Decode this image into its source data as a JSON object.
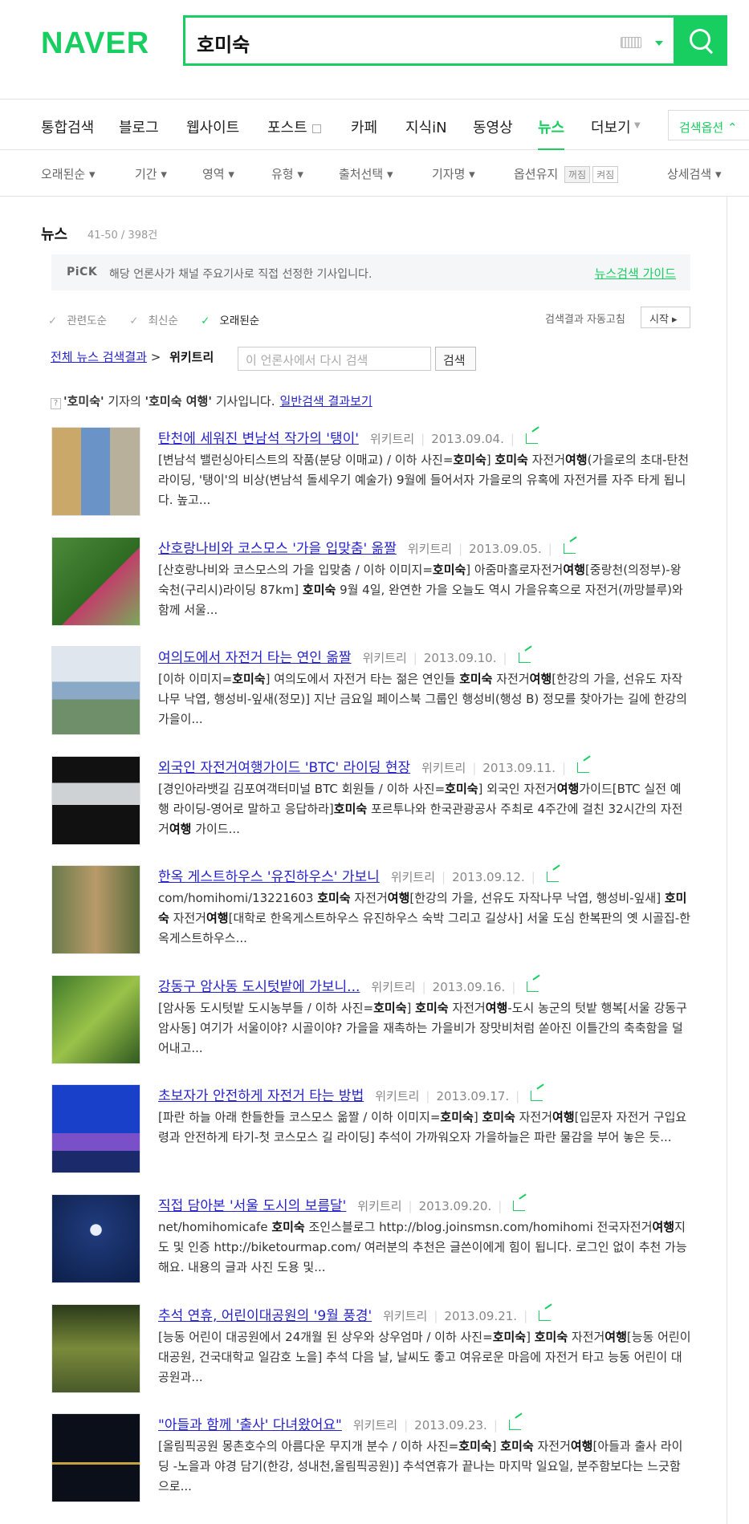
{
  "brand": {
    "logo": "NAVER",
    "brand_color": "#19ce60"
  },
  "search": {
    "query": "호미숙"
  },
  "tabs": [
    {
      "label": "통합검색"
    },
    {
      "label": "블로그"
    },
    {
      "label": "웹사이트"
    },
    {
      "label": "포스트"
    },
    {
      "label": "카페"
    },
    {
      "label": "지식iN"
    },
    {
      "label": "동영상"
    },
    {
      "label": "뉴스"
    },
    {
      "label": "더보기"
    }
  ],
  "search_options": "검색옵션",
  "filters": {
    "sort": "오래된순",
    "period": "기간",
    "area": "영역",
    "type": "유형",
    "source": "출처선택",
    "reporter": "기자명",
    "keep_label": "옵션유지",
    "keep_on": "꺼짐",
    "keep_off": "켜짐",
    "detail": "상세검색"
  },
  "section": {
    "title": "뉴스",
    "count": "41-50 / 398건"
  },
  "pick": {
    "label": "PiCK",
    "text": "해당 언론사가 채널 주요기사로 직접 선정한 기사입니다.",
    "guide": "뉴스검색 가이드"
  },
  "sort_opts": [
    {
      "label": "관련도순"
    },
    {
      "label": "최신순"
    },
    {
      "label": "오래된순"
    }
  ],
  "autofix": {
    "label": "검색결과 자동고침",
    "button": "시작"
  },
  "press": {
    "all_link": "전체 뉴스 검색결과",
    "current": "위키트리",
    "placeholder": "이 언론사에서 다시 검색",
    "button": "검색"
  },
  "reporter_note": {
    "q": "?",
    "part1": "'호미숙'",
    "part2": " 기자의 ",
    "part3": "'호미숙 여행'",
    "part4": " 기사입니다.",
    "link": "일반검색 결과보기"
  },
  "articles": [
    {
      "title": "탄천에 세워진 변남석 작가의 '탱이'",
      "press": "위키트리",
      "date": "2013.09.04.",
      "desc": "[변남석 밸런싱아티스트의 작품(분당 이매교) / 이하 사진=호미숙] 호미숙 자전거여행(가을로의 초대-탄천 라이딩, '탱이'의 비상(변남석 돌세우기 예술가) 9월에 들어서자 가을로의 유혹에 자전거를 자주 타게 됩니다. 높고..."
    },
    {
      "title": "산호랑나비와 코스모스 '가을 입맞춤' 옮짤",
      "press": "위키트리",
      "date": "2013.09.05.",
      "desc": "[산호랑나비와 코스모스의 가을 입맞춤 / 이하 이미지=호미숙] 아줌마홀로자전거여행[중랑천(의정부)-왕숙천(구리시)라이딩 87km] 호미숙 9월 4일, 완연한 가을 오늘도 역시 가을유혹으로 자전거(까망블루)와 함께 서울..."
    },
    {
      "title": "여의도에서 자전거 타는 연인 옮짤",
      "press": "위키트리",
      "date": "2013.09.10.",
      "desc": "[이하 이미지=호미숙] 여의도에서 자전거 타는 젊은 연인들 호미숙 자전거여행[한강의 가을, 선유도 자작나무 낙엽, 행성비-잎새(정모)] 지난 금요일 페이스북 그룹인 행성비(행성 B) 정모를 찾아가는 길에 한강의 가을이..."
    },
    {
      "title": "외국인 자전거여행가이드 'BTC' 라이딩 현장",
      "press": "위키트리",
      "date": "2013.09.11.",
      "desc": "[경인아라뱃길 김포여객터미널 BTC 회원들 / 이하 사진=호미숙] 외국인 자전거여행가이드[BTC 실전 예행 라이딩-영어로 말하고 응답하라]호미숙 포르투나와 한국관광공사 주최로 4주간에 걸친 32시간의 자전거여행 가이드..."
    },
    {
      "title": "한옥 게스트하우스 '유진하우스' 가보니",
      "press": "위키트리",
      "date": "2013.09.12.",
      "desc": "com/homihomi/13221603 호미숙 자전거여행[한강의 가을, 선유도 자작나무 낙엽, 행성비-잎새] 호미숙 자전거여행[대학로 한옥게스트하우스 유진하우스 숙박 그리고 길상사] 서울 도심 한복판의 옛 시골집-한옥게스트하우스..."
    },
    {
      "title": "강동구 암사동 도시텃밭에 가보니...",
      "press": "위키트리",
      "date": "2013.09.16.",
      "desc": "[암사동 도시텃밭 도시농부들 / 이하 사진=호미숙] 호미숙 자전거여행-도시 농군의 텃밭 행복[서울 강동구 암사동] 여기가 서울이야? 시골이야? 가을을 재촉하는 가을비가 장맛비처럼 쏟아진 이틀간의 축축함을 덜어내고..."
    },
    {
      "title": "초보자가 안전하게 자전거 타는 방법",
      "press": "위키트리",
      "date": "2013.09.17.",
      "desc": "[파란 하늘 아래 한들한들 코스모스 옮짤 / 이하 이미지=호미숙] 호미숙 자전거여행[입문자 자전거 구입요령과 안전하게 타기-첫 코스모스 길 라이딩] 추석이 가까워오자 가을하늘은 파란 물감을 부어 놓은 듯..."
    },
    {
      "title": "직접 담아본 '서울 도시의 보름달'",
      "press": "위키트리",
      "date": "2013.09.20.",
      "desc": "net/homihomicafe 호미숙 조인스블로그 http://blog.joinsmsn.com/homihomi 전국자전거여행지도 및 인증 http://biketourmap.com/ 여러분의 추천은 글쓴이에게 힘이 됩니다. 로그인 없이 추천 가능해요. 내용의 글과 사진 도용 및..."
    },
    {
      "title": "추석 연휴, 어린이대공원의 '9월 풍경'",
      "press": "위키트리",
      "date": "2013.09.21.",
      "desc": "[능동 어린이 대공원에서 24개월 된 상우와 상우엄마 / 이하 사진=호미숙] 호미숙 자전거여행[능동 어린이대공원, 건국대학교 일감호 노을] 추석 다음 날, 날씨도 좋고 여유로운 마음에 자전거 타고 능동 어린이 대공원과..."
    },
    {
      "title": "\"아들과 함께 '출사' 다녀왔어요\"",
      "press": "위키트리",
      "date": "2013.09.23.",
      "desc": "[올림픽공원 몽촌호수의 아름다운 무지개 분수 / 이하 사진=호미숙] 호미숙 자전거여행[아들과 출사 라이딩 -노을과 야경 담기(한강, 성내천,올림픽공원)] 추석연휴가 끝나는 마지막 일요일, 분주함보다는 느긋함으로..."
    }
  ]
}
